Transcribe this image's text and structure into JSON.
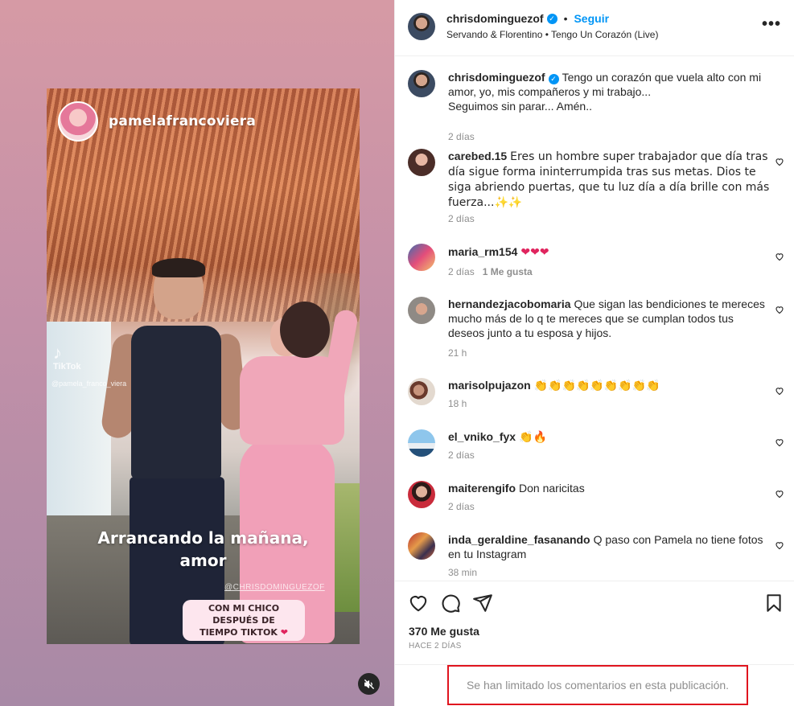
{
  "video": {
    "overlay_username": "pamelafrancoviera",
    "tiktok_label": "TikTok",
    "tiktok_handle": "@pamela_franco_viera",
    "caption_line1": "Arrancando la mañana,",
    "caption_line2": "amor",
    "handle_overlay": "@CHRISDOMINGUEZOF",
    "pill_line1": "CON MI CHICO DESPUÉS DE",
    "pill_line2": "TIEMPO TIKTOK",
    "pill_heart": "❤",
    "mute_icon": "speaker-muted-icon"
  },
  "header": {
    "username": "chrisdominguezof",
    "separator": "•",
    "follow_label": "Seguir",
    "song": "Servando & Florentino • Tengo Un Corazón (Live)",
    "more_label": "•••"
  },
  "caption": {
    "username": "chrisdominguezof",
    "text_line1": "Tengo un corazón que vuela alto con mi",
    "text_line2": "amor, yo, mis compañeros y mi trabajo...",
    "text_line3": "Seguimos sin parar... Amén..",
    "time": "2 días"
  },
  "comments": [
    {
      "username": "carebed.15",
      "text": "Eres un hombre super trabajador que día tras día sigue forma ininterrumpida tras sus metas. Dios te siga abriendo puertas, que tu luz día a día brille con más fuerza...✨✨",
      "time": "2 días",
      "likes": ""
    },
    {
      "username": "maria_rm154",
      "text": "❤❤❤",
      "time": "2 días",
      "likes": "1 Me gusta"
    },
    {
      "username": "hernandezjacobomaria",
      "text": "Que sigan las bendiciones te mereces mucho más de lo q te mereces que se cumplan todos tus deseos junto a tu esposa y hijos.",
      "time": "21 h",
      "likes": ""
    },
    {
      "username": "marisolpujazon",
      "text": "👏👏👏👏👏👏👏👏👏",
      "time": "18 h",
      "likes": ""
    },
    {
      "username": "el_vniko_fyx",
      "text": "👏🔥",
      "time": "2 días",
      "likes": ""
    },
    {
      "username": "maiterengifo",
      "text": "Don naricitas",
      "time": "2 días",
      "likes": ""
    },
    {
      "username": "inda_geraldine_fasanando",
      "text": "Q paso con Pamela no tiene fotos en tu Instagram",
      "time": "38 min",
      "likes": ""
    }
  ],
  "actions": {
    "likes": "370 Me gusta",
    "posted": "HACE 2 DÍAS"
  },
  "footer": {
    "limited_text": "Se han limitado los comentarios en esta publicación."
  },
  "colors": {
    "accent": "#0095f6",
    "highlight_border": "#e0141e",
    "muted_text": "#8e8e8e"
  }
}
